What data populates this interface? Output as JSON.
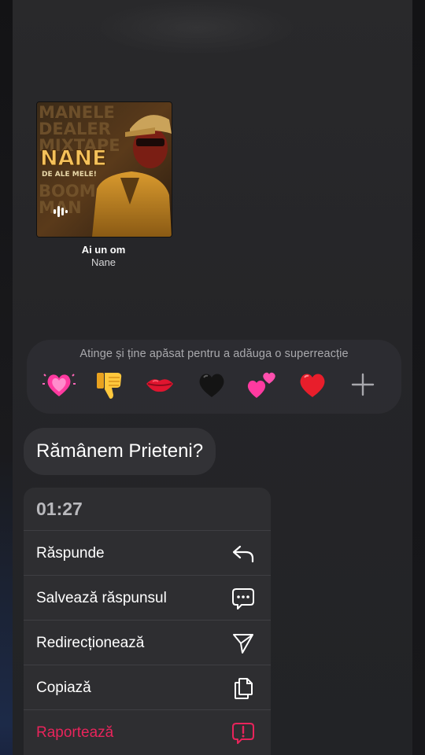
{
  "track": {
    "title": "Ai un om",
    "artist": "Nane"
  },
  "album_art": {
    "cover_text": "NANE",
    "cover_subtitle": "DE ALE MELE!",
    "background_words": [
      "MANELE",
      "DEALER",
      "MIXTAPE",
      "BOOM",
      "MAN"
    ]
  },
  "reactions": {
    "hint": "Atinge și ține apăsat pentru a adăuga o superreacție",
    "items": [
      {
        "name": "heart-pulse",
        "color": "#e8308a"
      },
      {
        "name": "thumbs-down",
        "color": "#f5b82e"
      },
      {
        "name": "kiss-lips",
        "color": "#e0152f"
      },
      {
        "name": "black-heart",
        "color": "#111111"
      },
      {
        "name": "two-hearts",
        "color": "#ec3aa0"
      },
      {
        "name": "red-heart",
        "color": "#e01e2b"
      },
      {
        "name": "plus",
        "color": "#a8a8ad"
      }
    ]
  },
  "message": {
    "text": "Rămânem Prieteni?"
  },
  "menu": {
    "timestamp": "01:27",
    "items": [
      {
        "label": "Răspunde",
        "icon": "reply-icon"
      },
      {
        "label": "Salvează răspunsul",
        "icon": "chat-bubble-dots-icon"
      },
      {
        "label": "Redirecționează",
        "icon": "send-icon"
      },
      {
        "label": "Copiază",
        "icon": "copy-icon"
      },
      {
        "label": "Raportează",
        "icon": "report-icon"
      }
    ],
    "danger_color": "#e8245b"
  }
}
